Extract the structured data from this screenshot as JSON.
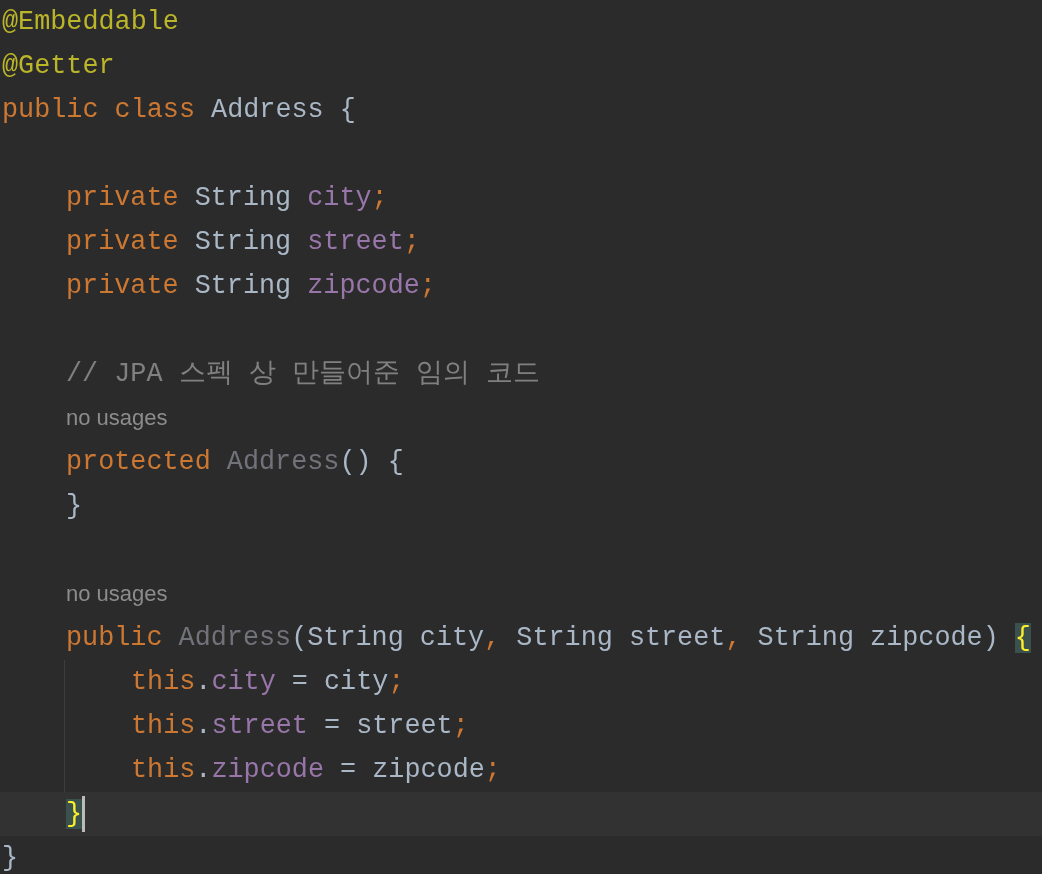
{
  "lines": [
    {
      "kind": "top",
      "tokens": [
        {
          "text": "@Embeddable",
          "kind": "annotation"
        }
      ]
    },
    {
      "kind": "top",
      "tokens": [
        {
          "text": "@Getter",
          "kind": "annotation"
        }
      ]
    },
    {
      "kind": "top",
      "tokens": [
        {
          "text": "public class ",
          "kind": "keyword"
        },
        {
          "text": "Address {",
          "kind": "plain"
        }
      ]
    },
    {
      "kind": "blank"
    },
    {
      "kind": "member",
      "tokens": [
        {
          "text": "private ",
          "kind": "keyword"
        },
        {
          "text": "String ",
          "kind": "plain"
        },
        {
          "text": "city",
          "kind": "field"
        },
        {
          "text": ";",
          "kind": "keyword"
        }
      ]
    },
    {
      "kind": "member",
      "tokens": [
        {
          "text": "private ",
          "kind": "keyword"
        },
        {
          "text": "String ",
          "kind": "plain"
        },
        {
          "text": "street",
          "kind": "field"
        },
        {
          "text": ";",
          "kind": "keyword"
        }
      ]
    },
    {
      "kind": "member",
      "tokens": [
        {
          "text": "private ",
          "kind": "keyword"
        },
        {
          "text": "String ",
          "kind": "plain"
        },
        {
          "text": "zipcode",
          "kind": "field"
        },
        {
          "text": ";",
          "kind": "keyword"
        }
      ]
    },
    {
      "kind": "blank"
    },
    {
      "kind": "member",
      "tokens": [
        {
          "text": "// JPA 스펙 상 만들어준 임의 코드",
          "kind": "comment"
        }
      ]
    },
    {
      "kind": "member",
      "tokens": [
        {
          "text": "no usages",
          "kind": "hint"
        }
      ]
    },
    {
      "kind": "member",
      "tokens": [
        {
          "text": "protected ",
          "kind": "keyword"
        },
        {
          "text": "Address",
          "kind": "unused"
        },
        {
          "text": "() {",
          "kind": "plain"
        }
      ]
    },
    {
      "kind": "member",
      "tokens": [
        {
          "text": "}",
          "kind": "plain"
        }
      ]
    },
    {
      "kind": "blank"
    },
    {
      "kind": "member",
      "tokens": [
        {
          "text": "no usages",
          "kind": "hint"
        }
      ]
    },
    {
      "kind": "member",
      "tokens": [
        {
          "text": "public ",
          "kind": "keyword"
        },
        {
          "text": "Address",
          "kind": "unused"
        },
        {
          "text": "(String city",
          "kind": "plain"
        },
        {
          "text": ", ",
          "kind": "keyword"
        },
        {
          "text": "String street",
          "kind": "plain"
        },
        {
          "text": ", ",
          "kind": "keyword"
        },
        {
          "text": "String zipcode) ",
          "kind": "plain"
        },
        {
          "text": "{",
          "kind": "brace_match"
        }
      ]
    },
    {
      "kind": "statement",
      "guide": true,
      "tokens": [
        {
          "text": "this",
          "kind": "keyword"
        },
        {
          "text": ".",
          "kind": "plain"
        },
        {
          "text": "city",
          "kind": "field"
        },
        {
          "text": " = city",
          "kind": "plain"
        },
        {
          "text": ";",
          "kind": "keyword"
        }
      ]
    },
    {
      "kind": "statement",
      "guide": true,
      "tokens": [
        {
          "text": "this",
          "kind": "keyword"
        },
        {
          "text": ".",
          "kind": "plain"
        },
        {
          "text": "street",
          "kind": "field"
        },
        {
          "text": " = street",
          "kind": "plain"
        },
        {
          "text": ";",
          "kind": "keyword"
        }
      ]
    },
    {
      "kind": "statement",
      "guide": true,
      "tokens": [
        {
          "text": "this",
          "kind": "keyword"
        },
        {
          "text": ".",
          "kind": "plain"
        },
        {
          "text": "zipcode",
          "kind": "field"
        },
        {
          "text": " = zipcode",
          "kind": "plain"
        },
        {
          "text": ";",
          "kind": "keyword"
        }
      ]
    },
    {
      "kind": "member",
      "current": true,
      "caret": true,
      "tokens": [
        {
          "text": "}",
          "kind": "brace_match"
        }
      ]
    },
    {
      "kind": "top",
      "tokens": [
        {
          "text": "}",
          "kind": "plain"
        }
      ]
    }
  ]
}
